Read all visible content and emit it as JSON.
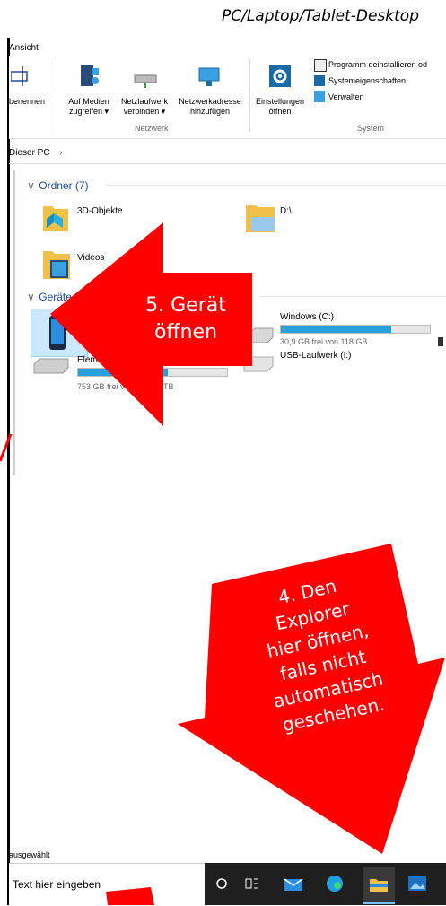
{
  "caption": "PC/Laptop/Tablet-Desktop",
  "ribbon": {
    "tab": "Ansicht",
    "buttons": [
      {
        "label1": "benennen",
        "label2": ""
      },
      {
        "label1": "Auf Medien",
        "label2": "zugreifen ▾"
      },
      {
        "label1": "Netzlaufwerk",
        "label2": "verbinden ▾"
      },
      {
        "label1": "Netzwerkadresse",
        "label2": "hinzufügen"
      },
      {
        "label1": "Einstellungen",
        "label2": "öffnen"
      }
    ],
    "system_items": [
      "Programm deinstallieren od",
      "Systemeigenschaften",
      "Verwalten"
    ],
    "groups": {
      "netzwerk": "Netzwerk",
      "system": "System"
    }
  },
  "address": {
    "path": "Dieser PC",
    "chevron": "›"
  },
  "folders": {
    "header": "Ordner (7)",
    "items": [
      "3D-Objekte",
      "D:\\",
      "Videos"
    ]
  },
  "devices": {
    "header": "Geräte und",
    "drives": [
      {
        "name": "Windows (C:)",
        "free": "30,9 GB frei von 118 GB",
        "used": 0.74
      },
      {
        "name": "Elemen",
        "free": "753 GB frei v",
        "suffix": "TB",
        "used": 0.6
      },
      {
        "name": "USB-Laufwerk (I:)"
      }
    ]
  },
  "status": {
    "text": "ausgewählt"
  },
  "taskbar": {
    "search_placeholder": "Text hier eingeben"
  },
  "annotations": {
    "step5": [
      "5. Gerät",
      "öffnen"
    ],
    "step4": [
      "4. Den",
      "Explorer",
      "hier öffnen,",
      "falls nicht",
      "automatisch",
      "geschehen."
    ]
  },
  "colors": {
    "annotation": "#ff0000",
    "accent": "#26a0da",
    "taskbar": "#1f1f1f"
  }
}
